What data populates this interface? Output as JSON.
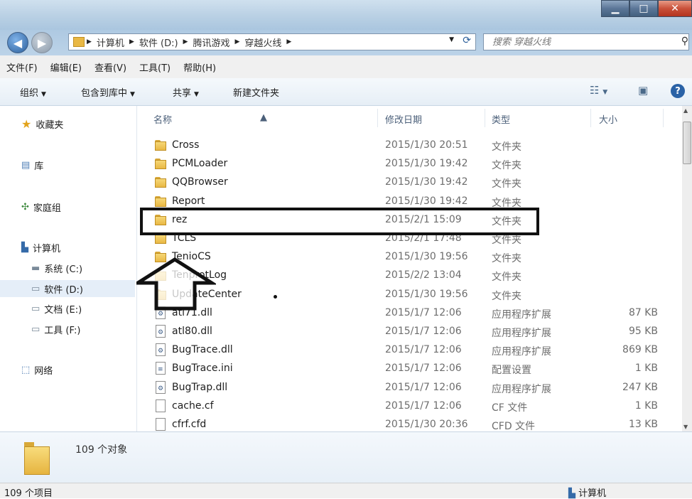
{
  "window": {
    "min_label": "▁",
    "max_label": "□",
    "close_label": "✕"
  },
  "nav": {
    "crumbs": [
      "计算机",
      "软件 (D:)",
      "腾讯游戏",
      "穿越火线"
    ],
    "search_placeholder": "搜索 穿越火线"
  },
  "menu": [
    "文件(F)",
    "编辑(E)",
    "查看(V)",
    "工具(T)",
    "帮助(H)"
  ],
  "toolbar": {
    "organize": "组织",
    "include": "包含到库中",
    "share": "共享",
    "newfolder": "新建文件夹"
  },
  "sidebar": {
    "favorites": "收藏夹",
    "libraries": "库",
    "homegroup": "家庭组",
    "computer": "计算机",
    "drives": [
      "系统 (C:)",
      "软件 (D:)",
      "文档 (E:)",
      "工具 (F:)"
    ],
    "network": "网络"
  },
  "columns": {
    "name": "名称",
    "date": "修改日期",
    "type": "类型",
    "size": "大小"
  },
  "files": [
    {
      "name": "Cross",
      "date": "2015/1/30 20:51",
      "type": "文件夹",
      "size": "",
      "kind": "folder"
    },
    {
      "name": "PCMLoader",
      "date": "2015/1/30 19:42",
      "type": "文件夹",
      "size": "",
      "kind": "folder"
    },
    {
      "name": "QQBrowser",
      "date": "2015/1/30 19:42",
      "type": "文件夹",
      "size": "",
      "kind": "folder"
    },
    {
      "name": "Report",
      "date": "2015/1/30 19:42",
      "type": "文件夹",
      "size": "",
      "kind": "folder"
    },
    {
      "name": "rez",
      "date": "2015/2/1 15:09",
      "type": "文件夹",
      "size": "",
      "kind": "folder"
    },
    {
      "name": "TCLS",
      "date": "2015/2/1 17:48",
      "type": "文件夹",
      "size": "",
      "kind": "folder"
    },
    {
      "name": "TenioCS",
      "date": "2015/1/30 19:56",
      "type": "文件夹",
      "size": "",
      "kind": "folder"
    },
    {
      "name": "TenprotLog",
      "date": "2015/2/2 13:04",
      "type": "文件夹",
      "size": "",
      "kind": "folder"
    },
    {
      "name": "UpdateCenter",
      "date": "2015/1/30 19:56",
      "type": "文件夹",
      "size": "",
      "kind": "folder"
    },
    {
      "name": "atl71.dll",
      "date": "2015/1/7 12:06",
      "type": "应用程序扩展",
      "size": "87 KB",
      "kind": "dll"
    },
    {
      "name": "atl80.dll",
      "date": "2015/1/7 12:06",
      "type": "应用程序扩展",
      "size": "95 KB",
      "kind": "dll"
    },
    {
      "name": "BugTrace.dll",
      "date": "2015/1/7 12:06",
      "type": "应用程序扩展",
      "size": "869 KB",
      "kind": "dll"
    },
    {
      "name": "BugTrace.ini",
      "date": "2015/1/7 12:06",
      "type": "配置设置",
      "size": "1 KB",
      "kind": "ini"
    },
    {
      "name": "BugTrap.dll",
      "date": "2015/1/7 12:06",
      "type": "应用程序扩展",
      "size": "247 KB",
      "kind": "dll"
    },
    {
      "name": "cache.cf",
      "date": "2015/1/7 12:06",
      "type": "CF 文件",
      "size": "1 KB",
      "kind": "blank"
    },
    {
      "name": "cfrf.cfd",
      "date": "2015/1/30 20:36",
      "type": "CFD 文件",
      "size": "13 KB",
      "kind": "blank"
    }
  ],
  "details": {
    "count": "109 个对象"
  },
  "status": {
    "left": "109 个项目",
    "right": "计算机"
  }
}
